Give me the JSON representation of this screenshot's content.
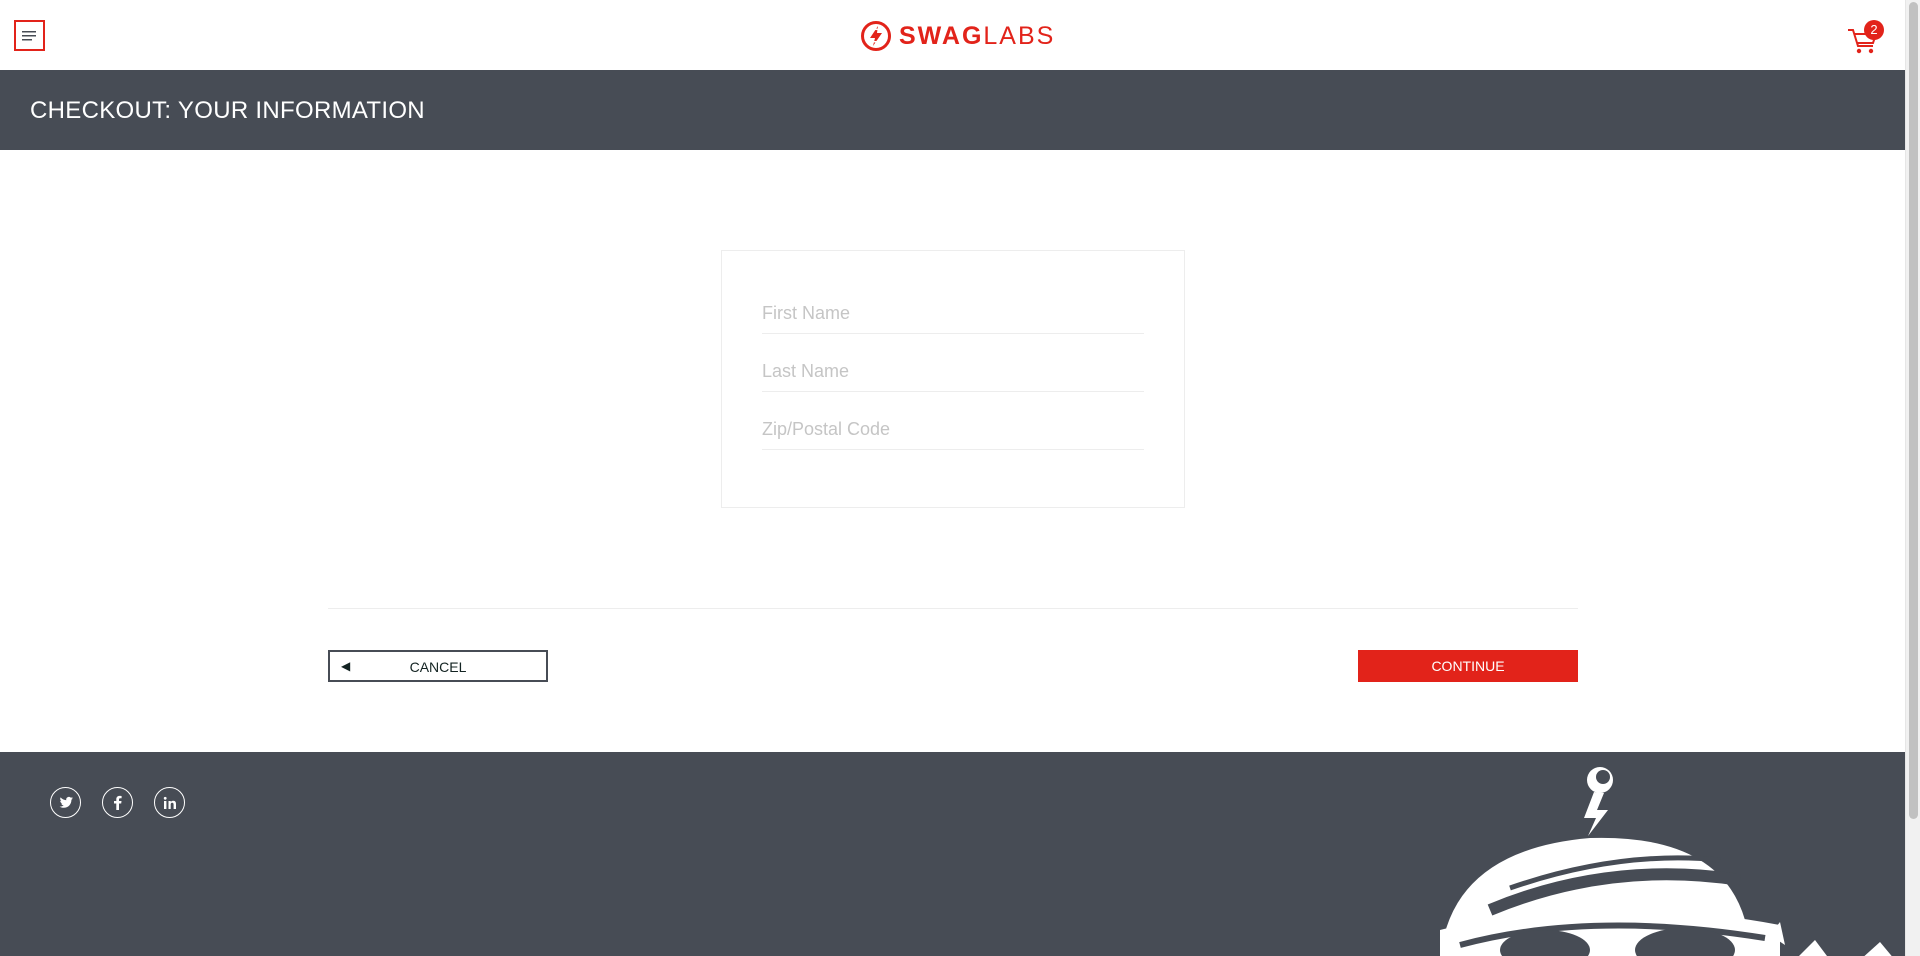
{
  "header": {
    "logo_bold": "SWAG",
    "logo_light": "LABS",
    "cart_count": "2"
  },
  "page": {
    "title": "CHECKOUT: YOUR INFORMATION"
  },
  "form": {
    "first_name": {
      "placeholder": "First Name",
      "value": ""
    },
    "last_name": {
      "placeholder": "Last Name",
      "value": ""
    },
    "postal_code": {
      "placeholder": "Zip/Postal Code",
      "value": ""
    }
  },
  "actions": {
    "cancel_arrow": "◀",
    "cancel_label": "CANCEL",
    "continue_label": "CONTINUE"
  },
  "footer": {
    "social": [
      "twitter-icon",
      "facebook-icon",
      "linkedin-icon"
    ]
  },
  "colors": {
    "brand": "#e2231a",
    "dark": "#474c55"
  }
}
